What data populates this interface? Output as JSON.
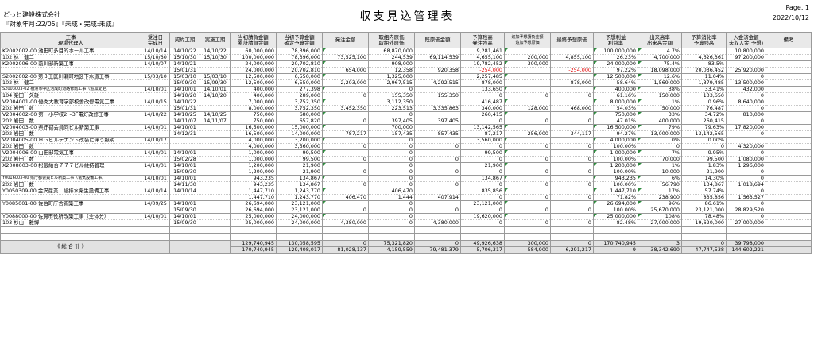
{
  "header": {
    "company": "どっと建設株式会社",
    "filter": "『対象年月:22/05』『未成・完成:未成』",
    "title": "収支見込管理表",
    "page": "Page.  1",
    "date": "2022/10/12"
  },
  "columns": {
    "c1a": "工事",
    "c1b": "現場代理人",
    "c2a": "受注日",
    "c2b": "完成日",
    "c3": "契約工期",
    "c4": "実施工期",
    "c5a": "当初請負金額",
    "c5b": "累計請負金額",
    "c6a": "当初予算金額",
    "c6b": "確定予算金額",
    "c7": "発注金額",
    "c8a": "取組内原価",
    "c8b": "取組外原価",
    "c9": "既原価金額",
    "c10a": "予算残高",
    "c10b": "発注残高",
    "c11a": "追加予想請負金額",
    "c11b": "追加予想原価",
    "c12": "最終予想原価",
    "c13a": "予想利益",
    "c13b": "利益率",
    "c14a": "出来高率",
    "c14b": "出来高金額",
    "c15a": "予算消化率",
    "c15b": "予算残高",
    "c16a": "入金済金額",
    "c16b": "未収入金(予想)",
    "c17": "備考"
  },
  "rows": [
    {
      "a": {
        "name": "K2002002-00  池田町多目的ホール工事",
        "d1": "14/10/14",
        "k": "14/10/22",
        "j": "14/10/22",
        "u": "60,000,000",
        "y": "78,396,000",
        "h": "",
        "ti": "68,870,000",
        "ki": "",
        "zy": "9,281,461",
        "ad": "",
        "sa": "",
        "rk": "100,000,000",
        "sr": "4.7%",
        "sc": "",
        "nk": "10,800,000"
      },
      "b": {
        "name": "102 林　健二",
        "d1": "15/10/30",
        "k": "15/10/30",
        "j": "15/10/30",
        "u": "100,000,000",
        "y": "78,396,000",
        "h": "73,525,100",
        "ti": "244,539",
        "ki": "69,114,539",
        "zy": "4,655,100",
        "ad": "200,000",
        "sa": "4,855,100",
        "rk": "26.23%",
        "sr": "4,700,000",
        "sc": "4,626,361",
        "nk": "97,200,000"
      }
    },
    {
      "a": {
        "name": "K2002006-00  前川邸新築工事",
        "d1": "14/10/07",
        "k": "14/10/21",
        "j": "",
        "u": "24,000,000",
        "y": "20,702,810",
        "h": "",
        "ti": "908,000",
        "ki": "",
        "zy": "19,782,452",
        "ad": "300,000",
        "sa": "",
        "rk": "24,000,000",
        "sr": "75.4%",
        "sc": "83.5%",
        "nk": ""
      },
      "b": {
        "name": "",
        "d1": "",
        "k": "15/01/31",
        "j": "",
        "u": "24,000,000",
        "y": "20,702,810",
        "h": "654,000",
        "ti": "12,358",
        "ki": "920,358",
        "zy": "-254,000",
        "ad": "",
        "sa": "-254,000",
        "rk": "97.22%",
        "sr": "18,098,000",
        "sc": "20,036,452",
        "nk": "25,920,000",
        "neg": true
      }
    },
    {
      "a": {
        "name": "S2002002-00  第３工区川瀬町地区下水道工事",
        "d1": "15/03/10",
        "k": "15/03/10",
        "j": "15/03/10",
        "u": "12,500,000",
        "y": "6,550,000",
        "h": "",
        "ti": "1,325,000",
        "ki": "",
        "zy": "2,257,485",
        "ad": "",
        "sa": "",
        "rk": "12,500,000",
        "sr": "12.6%",
        "sc": "11.04%",
        "nk": "0"
      },
      "b": {
        "name": "102 林　健二",
        "d1": "",
        "k": "15/09/30",
        "j": "15/09/30",
        "u": "12,500,000",
        "y": "6,550,000",
        "h": "2,203,000",
        "ti": "2,967,515",
        "ki": "4,292,515",
        "zy": "878,000",
        "ad": "",
        "sa": "878,000",
        "rk": "58.64%",
        "sr": "1,569,000",
        "sc": "1,379,485",
        "nk": "13,500,000"
      }
    },
    {
      "a": {
        "name": "S2003003-02  横浜市中区河成町道路修繕工事（追加変更）",
        "d1": "14/10/01",
        "k": "14/10/01",
        "j": "14/10/01",
        "u": "400,000",
        "y": "277,398",
        "h": "",
        "ti": "0",
        "ki": "",
        "zy": "133,650",
        "ad": "",
        "sa": "",
        "rk": "400,000",
        "sr": "38%",
        "sc": "33.41%",
        "nk": "432,000",
        "small": true
      },
      "b": {
        "name": "104 柴田　久雄",
        "d1": "",
        "k": "14/10/20",
        "j": "14/10/20",
        "u": "400,000",
        "y": "289,000",
        "h": "0",
        "ti": "155,350",
        "ki": "155,350",
        "zy": "0",
        "ad": "0",
        "sa": "0",
        "rk": "61.16%",
        "sr": "150,000",
        "sc": "133,650",
        "nk": "0"
      }
    },
    {
      "a": {
        "name": "V2004001-00  優秀大教育学部校舎改修電気工事",
        "d1": "14/10/15",
        "k": "14/10/22",
        "j": "",
        "u": "7,000,000",
        "y": "3,752,350",
        "h": "",
        "ti": "3,112,350",
        "ki": "",
        "zy": "416,487",
        "ad": "",
        "sa": "",
        "rk": "8,000,000",
        "sr": "1%",
        "sc": "0.96%",
        "nk": "8,640,000"
      },
      "b": {
        "name": "202 岩田　数",
        "d1": "",
        "k": "15/01/31",
        "j": "",
        "u": "8,000,000",
        "y": "3,752,350",
        "h": "3,452,350",
        "ti": "223,513",
        "ki": "3,335,863",
        "zy": "340,000",
        "ad": "128,000",
        "sa": "468,000",
        "rk": "54.03%",
        "sr": "50,000",
        "sc": "76,487",
        "nk": "0"
      }
    },
    {
      "a": {
        "name": "V2004002-00  第一小学校2～3F電灯改修工事",
        "d1": "14/10/22",
        "k": "14/10/25",
        "j": "14/10/25",
        "u": "750,000",
        "y": "680,000",
        "h": "",
        "ti": "0",
        "ki": "",
        "zy": "260,415",
        "ad": "",
        "sa": "",
        "rk": "750,000",
        "sr": "33%",
        "sc": "34.72%",
        "nk": "810,000"
      },
      "b": {
        "name": "202 岩田　数",
        "d1": "",
        "k": "14/11/07",
        "j": "14/11/07",
        "u": "750,000",
        "y": "657,820",
        "h": "0",
        "ti": "397,405",
        "ki": "397,405",
        "zy": "0",
        "ad": "0",
        "sa": "0",
        "rk": "47.01%",
        "sr": "400,000",
        "sc": "260,415",
        "nk": "0"
      }
    },
    {
      "a": {
        "name": "V2004003-00  県庁都会員同ビル新築工事",
        "d1": "14/10/01",
        "k": "14/10/01",
        "j": "",
        "u": "16,500,000",
        "y": "15,000,000",
        "h": "",
        "ti": "700,000",
        "ki": "",
        "zy": "13,142,565",
        "ad": "",
        "sa": "",
        "rk": "16,500,000",
        "sr": "79%",
        "sc": "79.63%",
        "nk": "17,820,000"
      },
      "b": {
        "name": "202 岩田　数",
        "d1": "",
        "k": "14/12/31",
        "j": "",
        "u": "16,500,000",
        "y": "14,000,000",
        "h": "787,217",
        "ti": "157,435",
        "ki": "857,435",
        "zy": "87,217",
        "ad": "256,900",
        "sa": "344,117",
        "rk": "94.27%",
        "sr": "13,000,000",
        "sc": "13,142,565",
        "nk": "0"
      }
    },
    {
      "a": {
        "name": "V2004005-00  ＨＧビルテナント改装に伴う照明",
        "d1": "14/10/17",
        "k": "",
        "j": "",
        "u": "4,000,000",
        "y": "3,200,000",
        "h": "",
        "ti": "0",
        "ki": "",
        "zy": "3,560,000",
        "ad": "",
        "sa": "",
        "rk": "4,000,000",
        "sr": "0%",
        "sc": "0.00%",
        "nk": ""
      },
      "b": {
        "name": "202 岩田　数",
        "d1": "",
        "k": "",
        "j": "",
        "u": "4,000,000",
        "y": "3,560,000",
        "h": "0",
        "ti": "0",
        "ki": "0",
        "zy": "0",
        "ad": "0",
        "sa": "0",
        "rk": "100.00%",
        "sr": "0",
        "sc": "0",
        "nk": "4,320,000"
      }
    },
    {
      "a": {
        "name": "V2004006-00  山田邸電気工事",
        "d1": "14/10/01",
        "k": "14/10/01",
        "j": "",
        "u": "1,000,000",
        "y": "99,500",
        "h": "",
        "ti": "0",
        "ki": "",
        "zy": "99,500",
        "ad": "",
        "sa": "",
        "rk": "1,000,000",
        "sr": "7%",
        "sc": "9.95%",
        "nk": "0"
      },
      "b": {
        "name": "202 岩田　数",
        "d1": "",
        "k": "15/02/28",
        "j": "",
        "u": "1,000,000",
        "y": "99,500",
        "h": "0",
        "ti": "0",
        "ki": "0",
        "zy": "0",
        "ad": "0",
        "sa": "0",
        "rk": "100.00%",
        "sr": "70,000",
        "sc": "99,500",
        "nk": "1,080,000"
      }
    },
    {
      "a": {
        "name": "X2008003-00  松阪給合７７７ビル維持管理",
        "d1": "14/10/01",
        "k": "14/10/01",
        "j": "",
        "u": "1,200,000",
        "y": "21,900",
        "h": "",
        "ti": "0",
        "ki": "",
        "zy": "21,900",
        "ad": "",
        "sa": "",
        "rk": "1,200,000",
        "sr": "1%",
        "sc": "1.83%",
        "nk": "1,296,000"
      },
      "b": {
        "name": "",
        "d1": "",
        "k": "15/09/30",
        "j": "",
        "u": "1,200,000",
        "y": "21,900",
        "h": "0",
        "ti": "0",
        "ki": "0",
        "zy": "0",
        "ad": "0",
        "sa": "0",
        "rk": "100.00%",
        "sr": "10,000",
        "sc": "21,900",
        "nk": "0"
      }
    },
    {
      "a": {
        "name": "Y0016003-00  県庁都会員ビル新築工事（電気設備工事）",
        "d1": "14/10/01",
        "k": "14/10/01",
        "j": "",
        "u": "943,235",
        "y": "134,867",
        "h": "",
        "ti": "0",
        "ki": "",
        "zy": "134,867",
        "ad": "",
        "sa": "",
        "rk": "943,235",
        "sr": "6%",
        "sc": "14.30%",
        "nk": "0",
        "small": true
      },
      "b": {
        "name": "202 岩田　数",
        "d1": "",
        "k": "14/11/30",
        "j": "",
        "u": "943,235",
        "y": "134,867",
        "h": "0",
        "ti": "0",
        "ki": "0",
        "zy": "0",
        "ad": "0",
        "sa": "0",
        "rk": "100.00%",
        "sr": "56,790",
        "sc": "134,867",
        "nk": "1,018,694"
      }
    },
    {
      "a": {
        "name": "Y0050309-00  金沢産業　給排水衛生設備工事",
        "d1": "14/10/14",
        "k": "14/10/14",
        "j": "",
        "u": "1,447,710",
        "y": "1,243,770",
        "h": "",
        "ti": "406,470",
        "ki": "",
        "zy": "835,856",
        "ad": "",
        "sa": "",
        "rk": "1,447,710",
        "sr": "17%",
        "sc": "57.74%",
        "nk": "0"
      },
      "b": {
        "name": "",
        "d1": "",
        "k": "",
        "j": "",
        "u": "1,447,710",
        "y": "1,243,770",
        "h": "406,470",
        "ti": "1,444",
        "ki": "407,914",
        "zy": "0",
        "ad": "0",
        "sa": "0",
        "rk": "71.82%",
        "sr": "238,900",
        "sc": "835,856",
        "nk": "1,563,527"
      }
    },
    {
      "a": {
        "name": "Y0085001-00  佐伯町庁舎新築工事",
        "d1": "14/09/25",
        "k": "14/10/01",
        "j": "",
        "u": "26,694,000",
        "y": "23,121,000",
        "h": "",
        "ti": "0",
        "ki": "",
        "zy": "23,121,000",
        "ad": "",
        "sa": "",
        "rk": "26,694,000",
        "sr": "96%",
        "sc": "86.61%",
        "nk": "0"
      },
      "b": {
        "name": "",
        "d1": "",
        "k": "15/09/30",
        "j": "",
        "u": "26,694,000",
        "y": "23,121,000",
        "h": "0",
        "ti": "0",
        "ki": "0",
        "zy": "0",
        "ad": "0",
        "sa": "0",
        "rk": "100.00%",
        "sr": "25,670,000",
        "sc": "23,121,000",
        "nk": "28,829,520"
      }
    },
    {
      "a": {
        "name": "Y0088000-00  佐賀市役所改築工事（全体分）",
        "d1": "14/10/01",
        "k": "14/10/01",
        "j": "",
        "u": "25,000,000",
        "y": "24,000,000",
        "h": "",
        "ti": "0",
        "ki": "",
        "zy": "19,620,000",
        "ad": "",
        "sa": "",
        "rk": "25,000,000",
        "sr": "108%",
        "sc": "78.48%",
        "nk": "0"
      },
      "b": {
        "name": "103 杉山　雅博",
        "d1": "",
        "k": "15/09/30",
        "j": "",
        "u": "25,000,000",
        "y": "24,000,000",
        "h": "4,380,000",
        "ti": "0",
        "ki": "4,380,000",
        "zy": "0",
        "ad": "0",
        "sa": "0",
        "rk": "82.48%",
        "sr": "27,000,000",
        "sc": "19,620,000",
        "nk": "27,000,000"
      }
    }
  ],
  "totals": {
    "label": "《 総 合 計 》",
    "a": {
      "u": "129,740,945",
      "y": "130,058,595",
      "h": "0",
      "ti": "75,321,820",
      "ki": "0",
      "zy": "49,926,638",
      "ad": "300,000",
      "sa": "0",
      "rk": "170,740,945",
      "sr": "3",
      "sc": "0",
      "nk": "39,798,000"
    },
    "b": {
      "u": "170,740,945",
      "y": "129,408,017",
      "h": "81,028,137",
      "ti": "4,159,559",
      "ki": "79,481,379",
      "zy": "5,706,317",
      "ad": "584,900",
      "sa": "6,291,217",
      "rk": "9",
      "sr": "38,342,690",
      "sc": "47,747,538",
      "nk": "144,602,221"
    }
  },
  "colors": {
    "header_bg": "#e9e9e9",
    "total_bg": "#e2e2e2",
    "negative": "#e00000",
    "marker": "#2e8b3e"
  }
}
